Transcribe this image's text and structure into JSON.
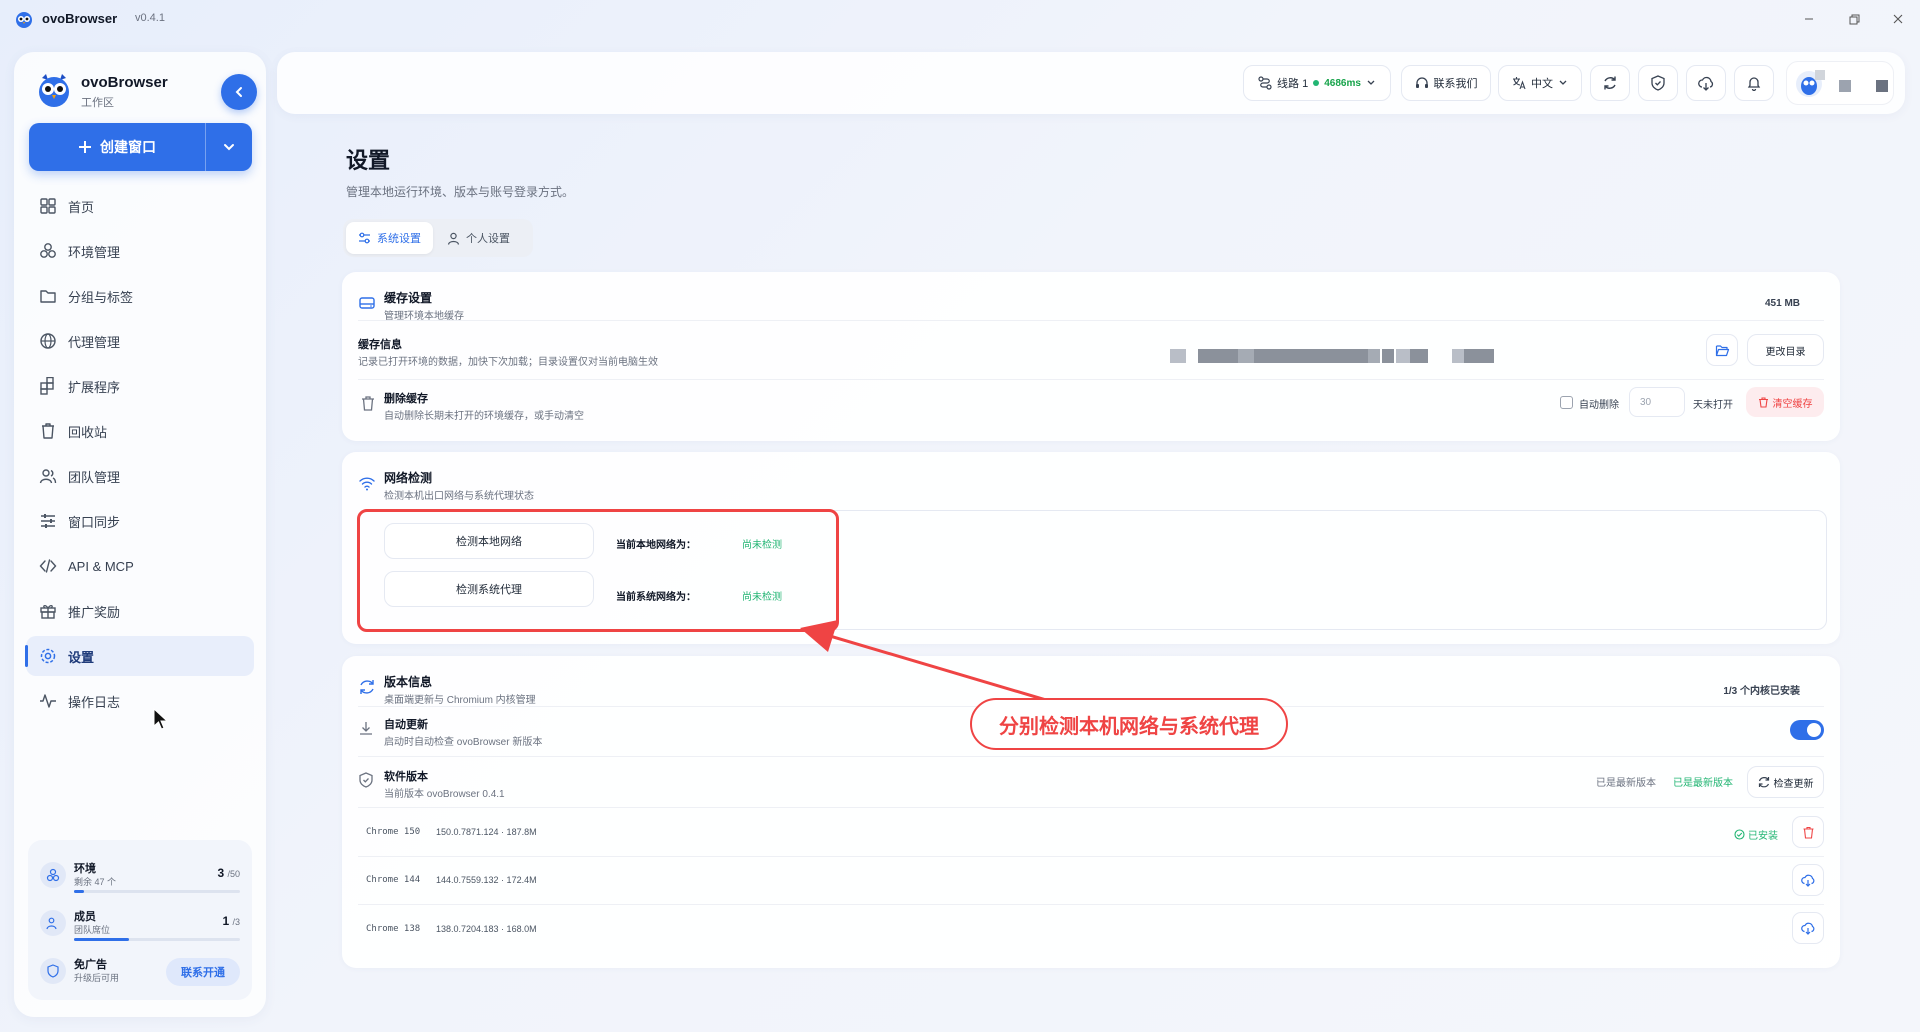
{
  "app": {
    "title": "ovoBrowser",
    "version": "v0.4.1"
  },
  "brand": {
    "name": "ovoBrowser",
    "subtitle": "工作区"
  },
  "create": {
    "label": "创建窗口"
  },
  "nav": [
    {
      "label": "首页",
      "icon": "grid-icon"
    },
    {
      "label": "环境管理",
      "icon": "cubes-icon"
    },
    {
      "label": "分组与标签",
      "icon": "folder-icon"
    },
    {
      "label": "代理管理",
      "icon": "globe-icon"
    },
    {
      "label": "扩展程序",
      "icon": "puzzle-icon"
    },
    {
      "label": "回收站",
      "icon": "trash-icon"
    },
    {
      "label": "团队管理",
      "icon": "users-icon"
    },
    {
      "label": "窗口同步",
      "icon": "sliders-icon"
    },
    {
      "label": "API & MCP",
      "icon": "code-icon"
    },
    {
      "label": "推广奖励",
      "icon": "gift-icon"
    },
    {
      "label": "设置",
      "icon": "gear-icon"
    },
    {
      "label": "操作日志",
      "icon": "activity-icon"
    }
  ],
  "active_nav": "设置",
  "quota": {
    "env": {
      "name": "环境",
      "sub": "剩余 47 个",
      "used": "3",
      "total": "/50",
      "fraction": 0.06
    },
    "member": {
      "name": "成员",
      "sub": "团队席位",
      "used": "1",
      "total": "/3",
      "fraction": 0.33
    },
    "ads": {
      "name": "免广告",
      "sub": "升级后可用",
      "button": "联系开通"
    }
  },
  "topbar": {
    "line": "线路 1",
    "latency": "4686ms",
    "contact": "联系我们",
    "language": "中文"
  },
  "page": {
    "title": "设置",
    "subtitle": "管理本地运行环境、版本与账号登录方式。",
    "tabs": [
      "系统设置",
      "个人设置"
    ]
  },
  "cache": {
    "title": "缓存设置",
    "subtitle": "管理环境本地缓存",
    "size": "451 MB",
    "info_title": "缓存信息",
    "info_sub": "记录已打开环境的数据，加快下次加载；目录设置仅对当前电脑生效",
    "change_dir": "更改目录",
    "delete_title": "删除缓存",
    "delete_sub": "自动删除长期未打开的环境缓存，或手动清空",
    "auto_delete": "自动删除",
    "days_placeholder": "30",
    "days_unopened": "天未打开",
    "clear": "清空缓存"
  },
  "network": {
    "title": "网络检测",
    "subtitle": "检测本机出口网络与系统代理状态",
    "btn_local": "检测本地网络",
    "btn_proxy": "检测系统代理",
    "label_local": "当前本地网络为：",
    "label_proxy": "当前系统网络为：",
    "val_local": "尚未检测",
    "val_proxy": "尚未检测"
  },
  "version": {
    "title": "版本信息",
    "subtitle": "桌面端更新与 Chromium 内核管理",
    "kernel_status": "1/3 个内核已安装",
    "auto_title": "自动更新",
    "auto_sub": "启动时自动检查 ovoBrowser 新版本",
    "soft_title": "软件版本",
    "soft_sub": "当前版本 ovoBrowser 0.4.1",
    "latest_gray": "已是最新版本",
    "latest_green": "已是最新版本",
    "check": "检查更新",
    "installed": "已安装",
    "kernels": [
      {
        "name": "Chrome 150",
        "detail": "150.0.7871.124 · 187.8M"
      },
      {
        "name": "Chrome 144",
        "detail": "144.0.7559.132 · 172.4M"
      },
      {
        "name": "Chrome 138",
        "detail": "138.0.7204.183 · 168.0M"
      }
    ]
  },
  "annotation": {
    "text": "分别检测本机网络与系统代理",
    "color": "#ef4444"
  },
  "colors": {
    "accent": "#2f6fe8",
    "success": "#22b573",
    "danger": "#ef4444"
  }
}
